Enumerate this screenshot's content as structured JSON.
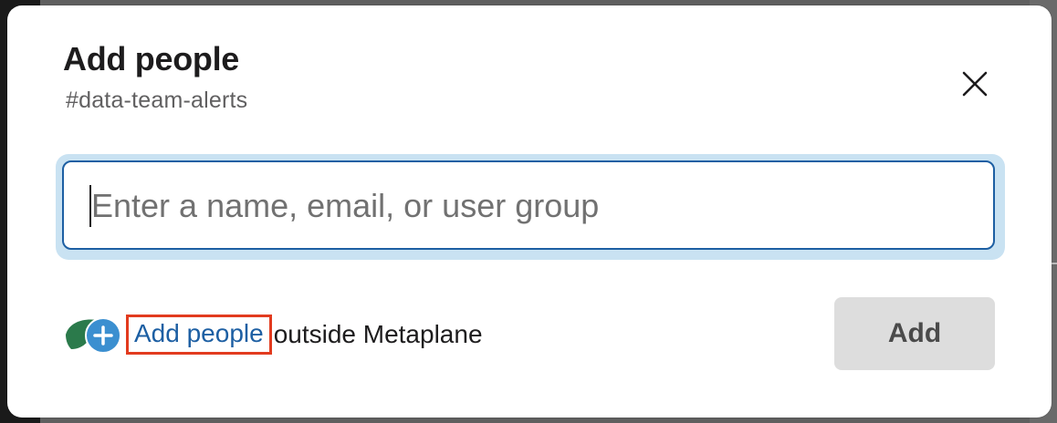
{
  "dialog": {
    "title": "Add people",
    "channel": "#data-team-alerts",
    "close_icon": "close-icon"
  },
  "search": {
    "placeholder": "Enter a name, email, or user group",
    "value": ""
  },
  "footer": {
    "icons": [
      "leaf-icon",
      "plus-circle-icon"
    ],
    "link_label": "Add people",
    "link_suffix": "outside Metaplane",
    "add_button_label": "Add"
  },
  "colors": {
    "link": "#1d5fa3",
    "focus_ring": "#c9e2f2",
    "highlight_box": "#e23b1f",
    "add_button_bg": "#dddddd",
    "leaf_icon": "#2b7a4b",
    "plus_icon": "#3b8fd0"
  }
}
